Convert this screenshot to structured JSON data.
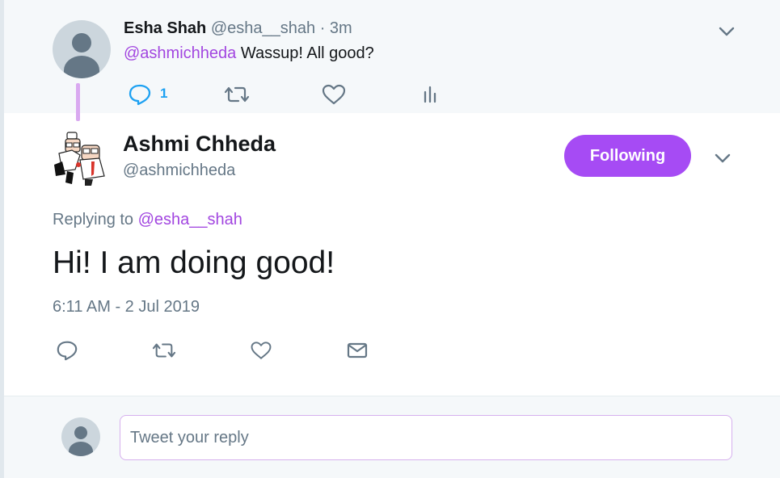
{
  "parent_tweet": {
    "name": "Esha Shah",
    "handle": "@esha__shah",
    "time": "· 3m",
    "mention": "@ashmichheda",
    "text": " Wassup! All good?",
    "reply_count": "1"
  },
  "main_tweet": {
    "name": "Ashmi Chheda",
    "handle": "@ashmichheda",
    "follow_label": "Following",
    "replying_prefix": "Replying to ",
    "replying_to": "@esha__shah",
    "text": "Hi! I am doing good!",
    "timestamp": "6:11 AM - 2 Jul 2019"
  },
  "composer": {
    "placeholder": "Tweet your reply"
  },
  "colors": {
    "accent": "#a64bf4",
    "mention": "#a246e0",
    "reply_blue": "#1da1f2",
    "muted": "#657786"
  },
  "icons": [
    "reply-icon",
    "retweet-icon",
    "like-icon",
    "analytics-icon",
    "chevron-down-icon",
    "direct-message-icon",
    "default-avatar-icon"
  ]
}
